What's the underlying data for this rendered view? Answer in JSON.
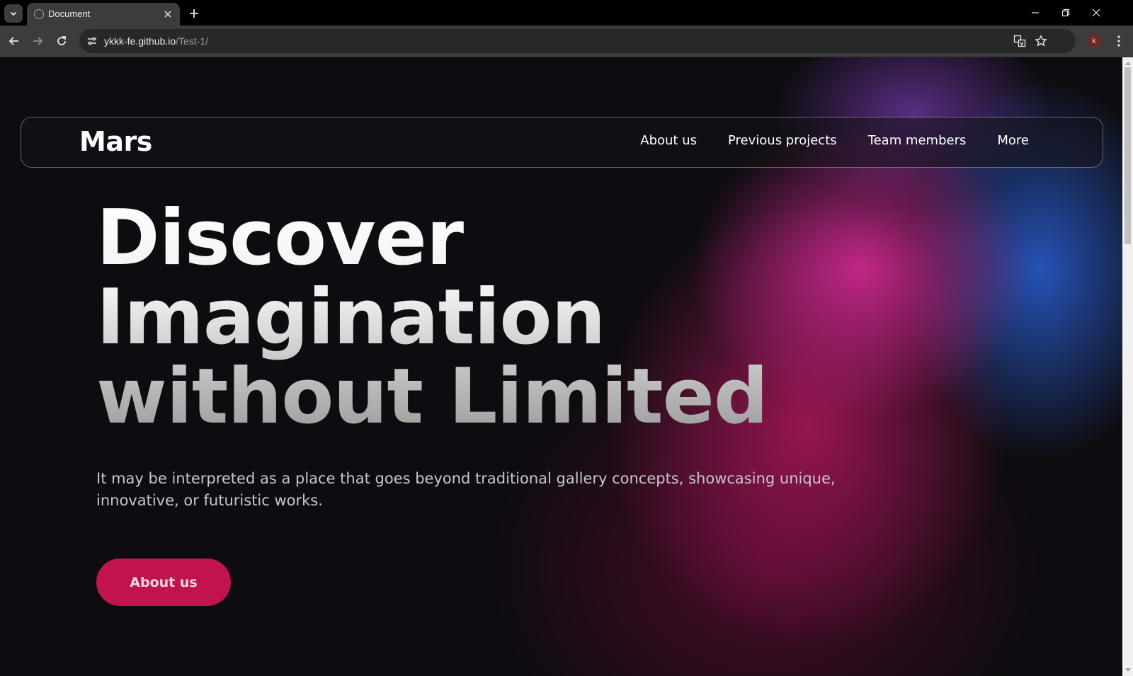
{
  "browser": {
    "tab": {
      "title": "Document"
    },
    "address_bar": {
      "host": "ykkk-fe.github.io",
      "path": "/Test-1/"
    },
    "profile_initial": "k",
    "icons": {
      "tab_search": "chevron-down-icon",
      "close_tab": "close-icon",
      "new_tab": "plus-icon",
      "minimize": "minimize-icon",
      "restore": "restore-icon",
      "close_window": "close-icon",
      "back": "arrow-left-icon",
      "forward": "arrow-right-icon",
      "reload": "reload-icon",
      "site_info": "tune-icon",
      "translate": "translate-icon",
      "bookmark": "star-icon",
      "menu": "kebab-menu-icon"
    }
  },
  "site": {
    "logo": "Mars",
    "nav": [
      {
        "label": "About us"
      },
      {
        "label": "Previous projects"
      },
      {
        "label": "Team members"
      },
      {
        "label": "More"
      }
    ],
    "hero": {
      "title_lines": [
        "Discover",
        "Imagination",
        "without Limited"
      ],
      "subtitle": "It may be interpreted as a place that goes beyond traditional gallery concepts, showcasing unique, innovative, or futuristic works.",
      "cta_label": "About us"
    },
    "colors": {
      "background": "#0e0c10",
      "accent_button": "#c1144c",
      "glow_pink": "#c8288c",
      "glow_blue": "#285ac8"
    }
  }
}
